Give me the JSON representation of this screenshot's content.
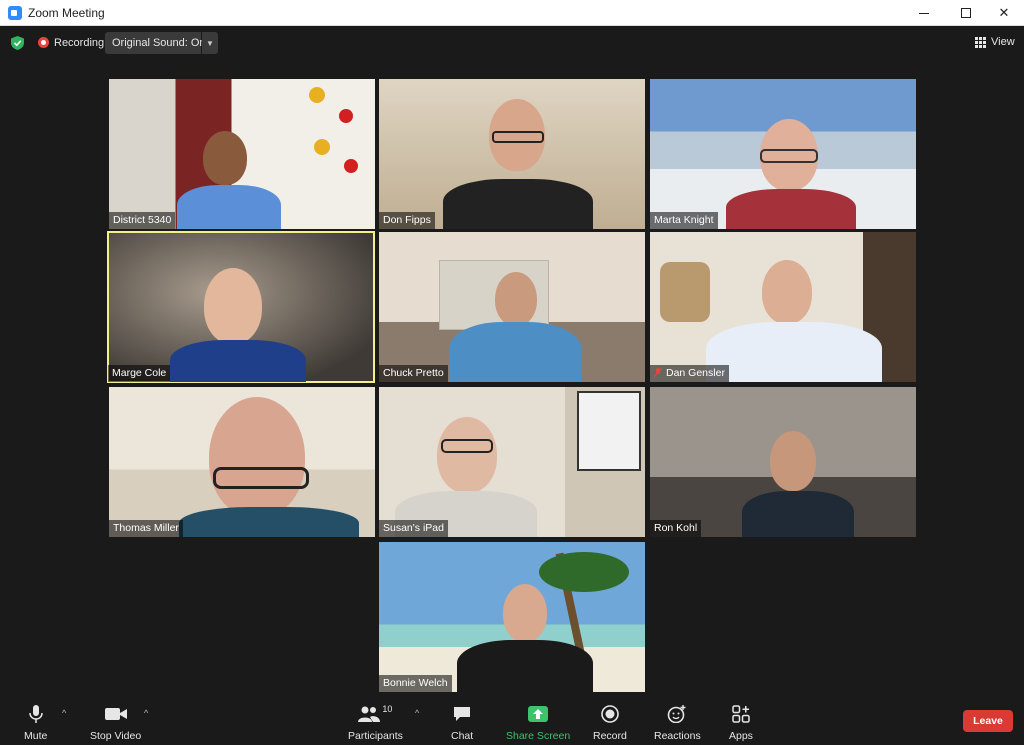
{
  "window": {
    "title": "Zoom Meeting",
    "minimize": "—",
    "maximize": "☐",
    "close": "✕"
  },
  "topbar": {
    "recording_label": "Recording",
    "original_sound": "Original Sound: On",
    "view_label": "View"
  },
  "participants": [
    {
      "name": "District 5340"
    },
    {
      "name": "Don Fipps"
    },
    {
      "name": "Marta Knight"
    },
    {
      "name": "Marge Cole",
      "active_speaker": true
    },
    {
      "name": "Chuck Pretto"
    },
    {
      "name": "Dan Gensler",
      "muted": true
    },
    {
      "name": "Thomas Miller"
    },
    {
      "name": "Susan's iPad"
    },
    {
      "name": "Ron Kohl"
    },
    {
      "name": "Bonnie Welch"
    }
  ],
  "toolbar": {
    "mute": "Mute",
    "stop_video": "Stop Video",
    "participants": "Participants",
    "participants_count": "10",
    "chat": "Chat",
    "share_screen": "Share Screen",
    "record": "Record",
    "reactions": "Reactions",
    "apps": "Apps",
    "leave": "Leave"
  },
  "colors": {
    "background": "#1a1a1a",
    "active_speaker_border": "#f3f08a",
    "share_green": "#3ec26b",
    "leave_red": "#d93a34",
    "recording_red": "#e8453c"
  }
}
